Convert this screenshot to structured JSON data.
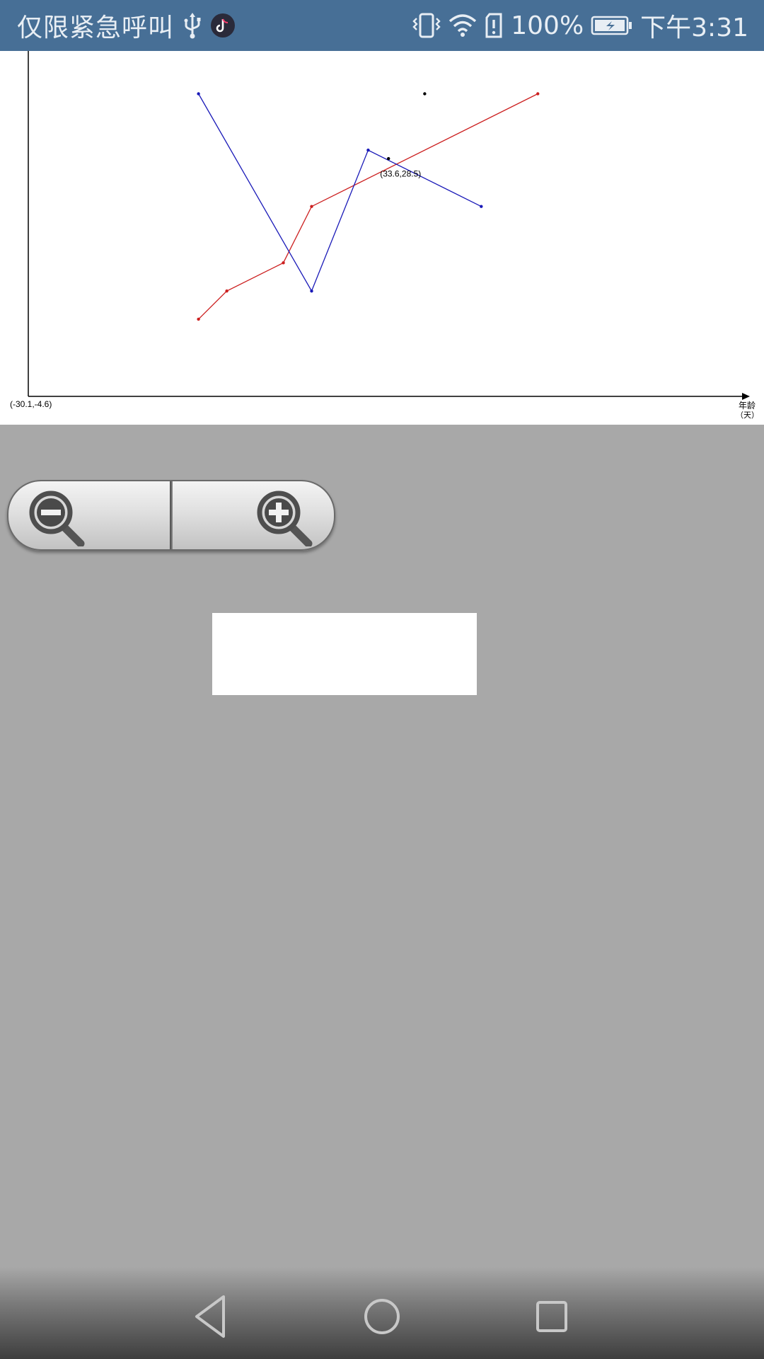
{
  "status_bar": {
    "carrier_text": "仅限紧急呼叫",
    "battery_percent": "100%",
    "time": "下午3:31",
    "icons": [
      "usb-icon",
      "tiktok-icon",
      "vibrate-icon",
      "wifi-icon",
      "sim-alert-icon",
      "battery-charging-icon"
    ]
  },
  "chart_data": {
    "type": "line",
    "x_axis_label_line1": "年龄",
    "x_axis_label_line2": "（天）",
    "origin_label": "(-30.1,-4.6)",
    "x_range": [
      -30.1,
      100
    ],
    "y_range": [
      -4.6,
      56.7
    ],
    "series": [
      {
        "color": "#cc2020",
        "points": [
          [
            0,
            9.1
          ],
          [
            5,
            14.1
          ],
          [
            15,
            19.1
          ],
          [
            20,
            29.1
          ],
          [
            60,
            49.1
          ]
        ]
      },
      {
        "color": "#1a1ab8",
        "points": [
          [
            0,
            49.1
          ],
          [
            20,
            14.1
          ],
          [
            30,
            39.1
          ],
          [
            50,
            29.1
          ]
        ]
      }
    ],
    "markers": [
      {
        "x": 40,
        "y": 49.1,
        "color": "#000000"
      },
      {
        "x": 33.6,
        "y": 37.6,
        "color": "#000000"
      }
    ],
    "annotations": [
      {
        "text": "(33.6,28.5)",
        "x": 33.6,
        "y": 34.4
      }
    ]
  },
  "zoom": {
    "zoom_out_icon": "zoom-out-icon",
    "zoom_in_icon": "zoom-in-icon"
  },
  "nav_bar": {
    "back_icon": "back-triangle-icon",
    "home_icon": "home-circle-icon",
    "recents_icon": "recents-square-icon"
  }
}
